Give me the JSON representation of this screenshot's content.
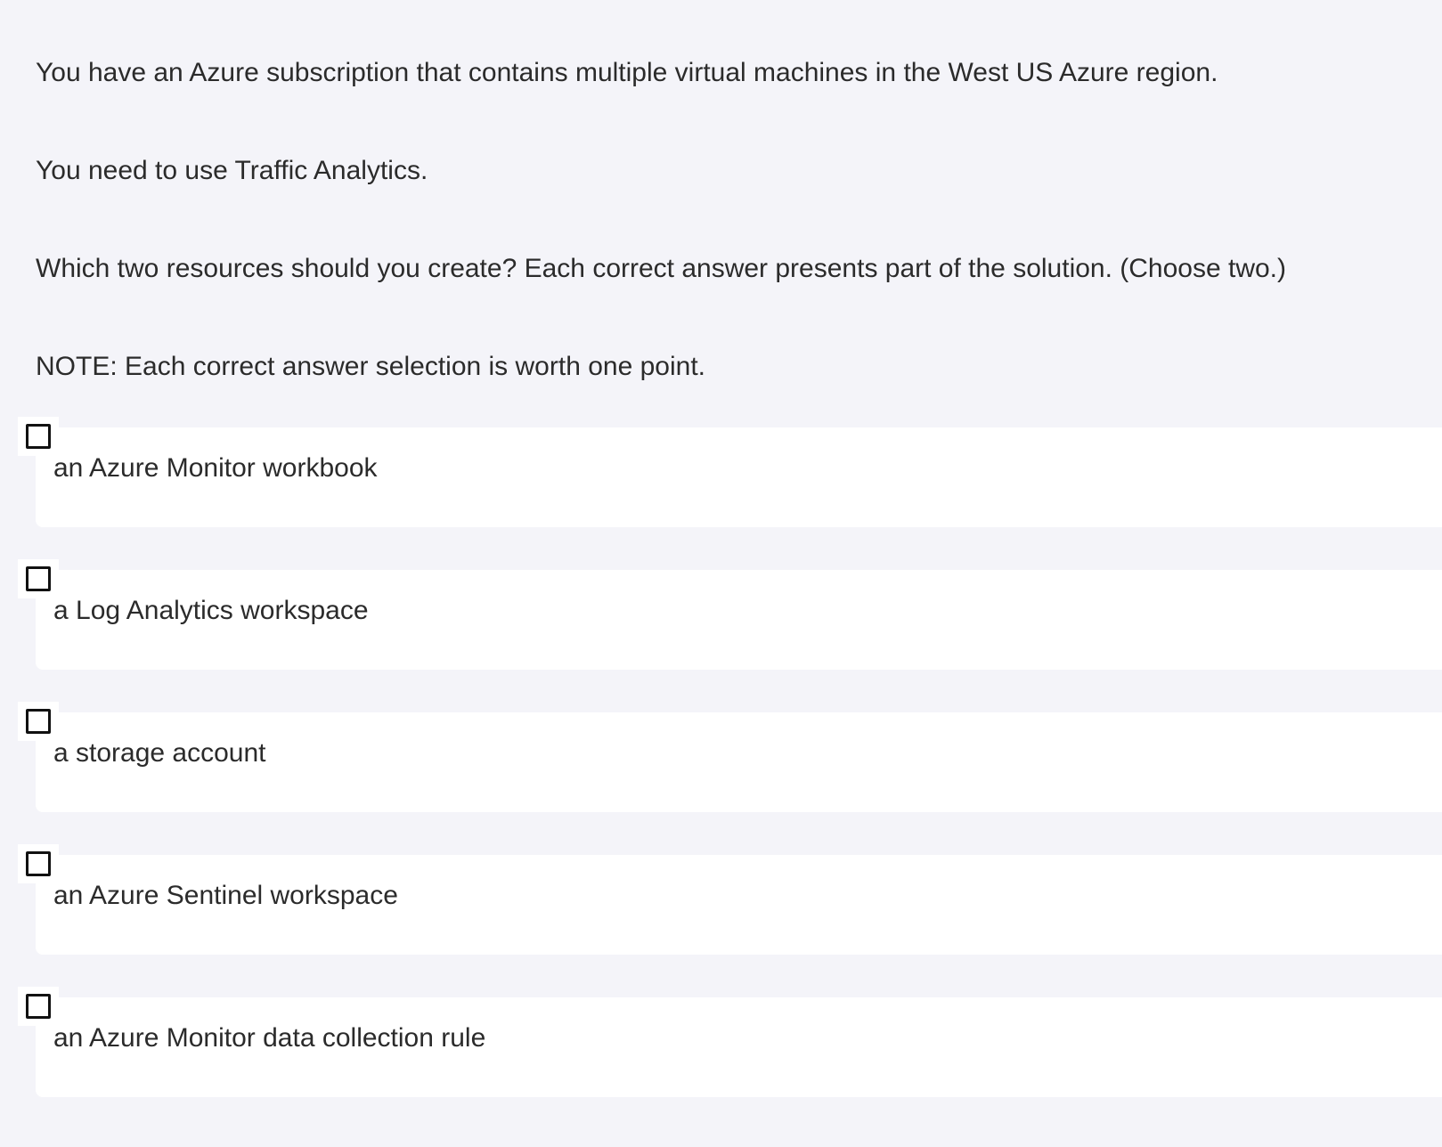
{
  "question": {
    "lines": [
      "You have an Azure subscription that contains multiple virtual machines in the West US Azure region.",
      "You need to use Traffic Analytics.",
      "Which two resources should you create? Each correct answer presents part of the solution. (Choose two.)",
      "NOTE: Each correct answer selection is worth one point."
    ]
  },
  "options": [
    {
      "label": "an Azure Monitor workbook",
      "checked": false
    },
    {
      "label": "a Log Analytics workspace",
      "checked": false
    },
    {
      "label": "a storage account",
      "checked": false
    },
    {
      "label": "an Azure Sentinel workspace",
      "checked": false
    },
    {
      "label": "an Azure Monitor data collection rule",
      "checked": false
    }
  ]
}
